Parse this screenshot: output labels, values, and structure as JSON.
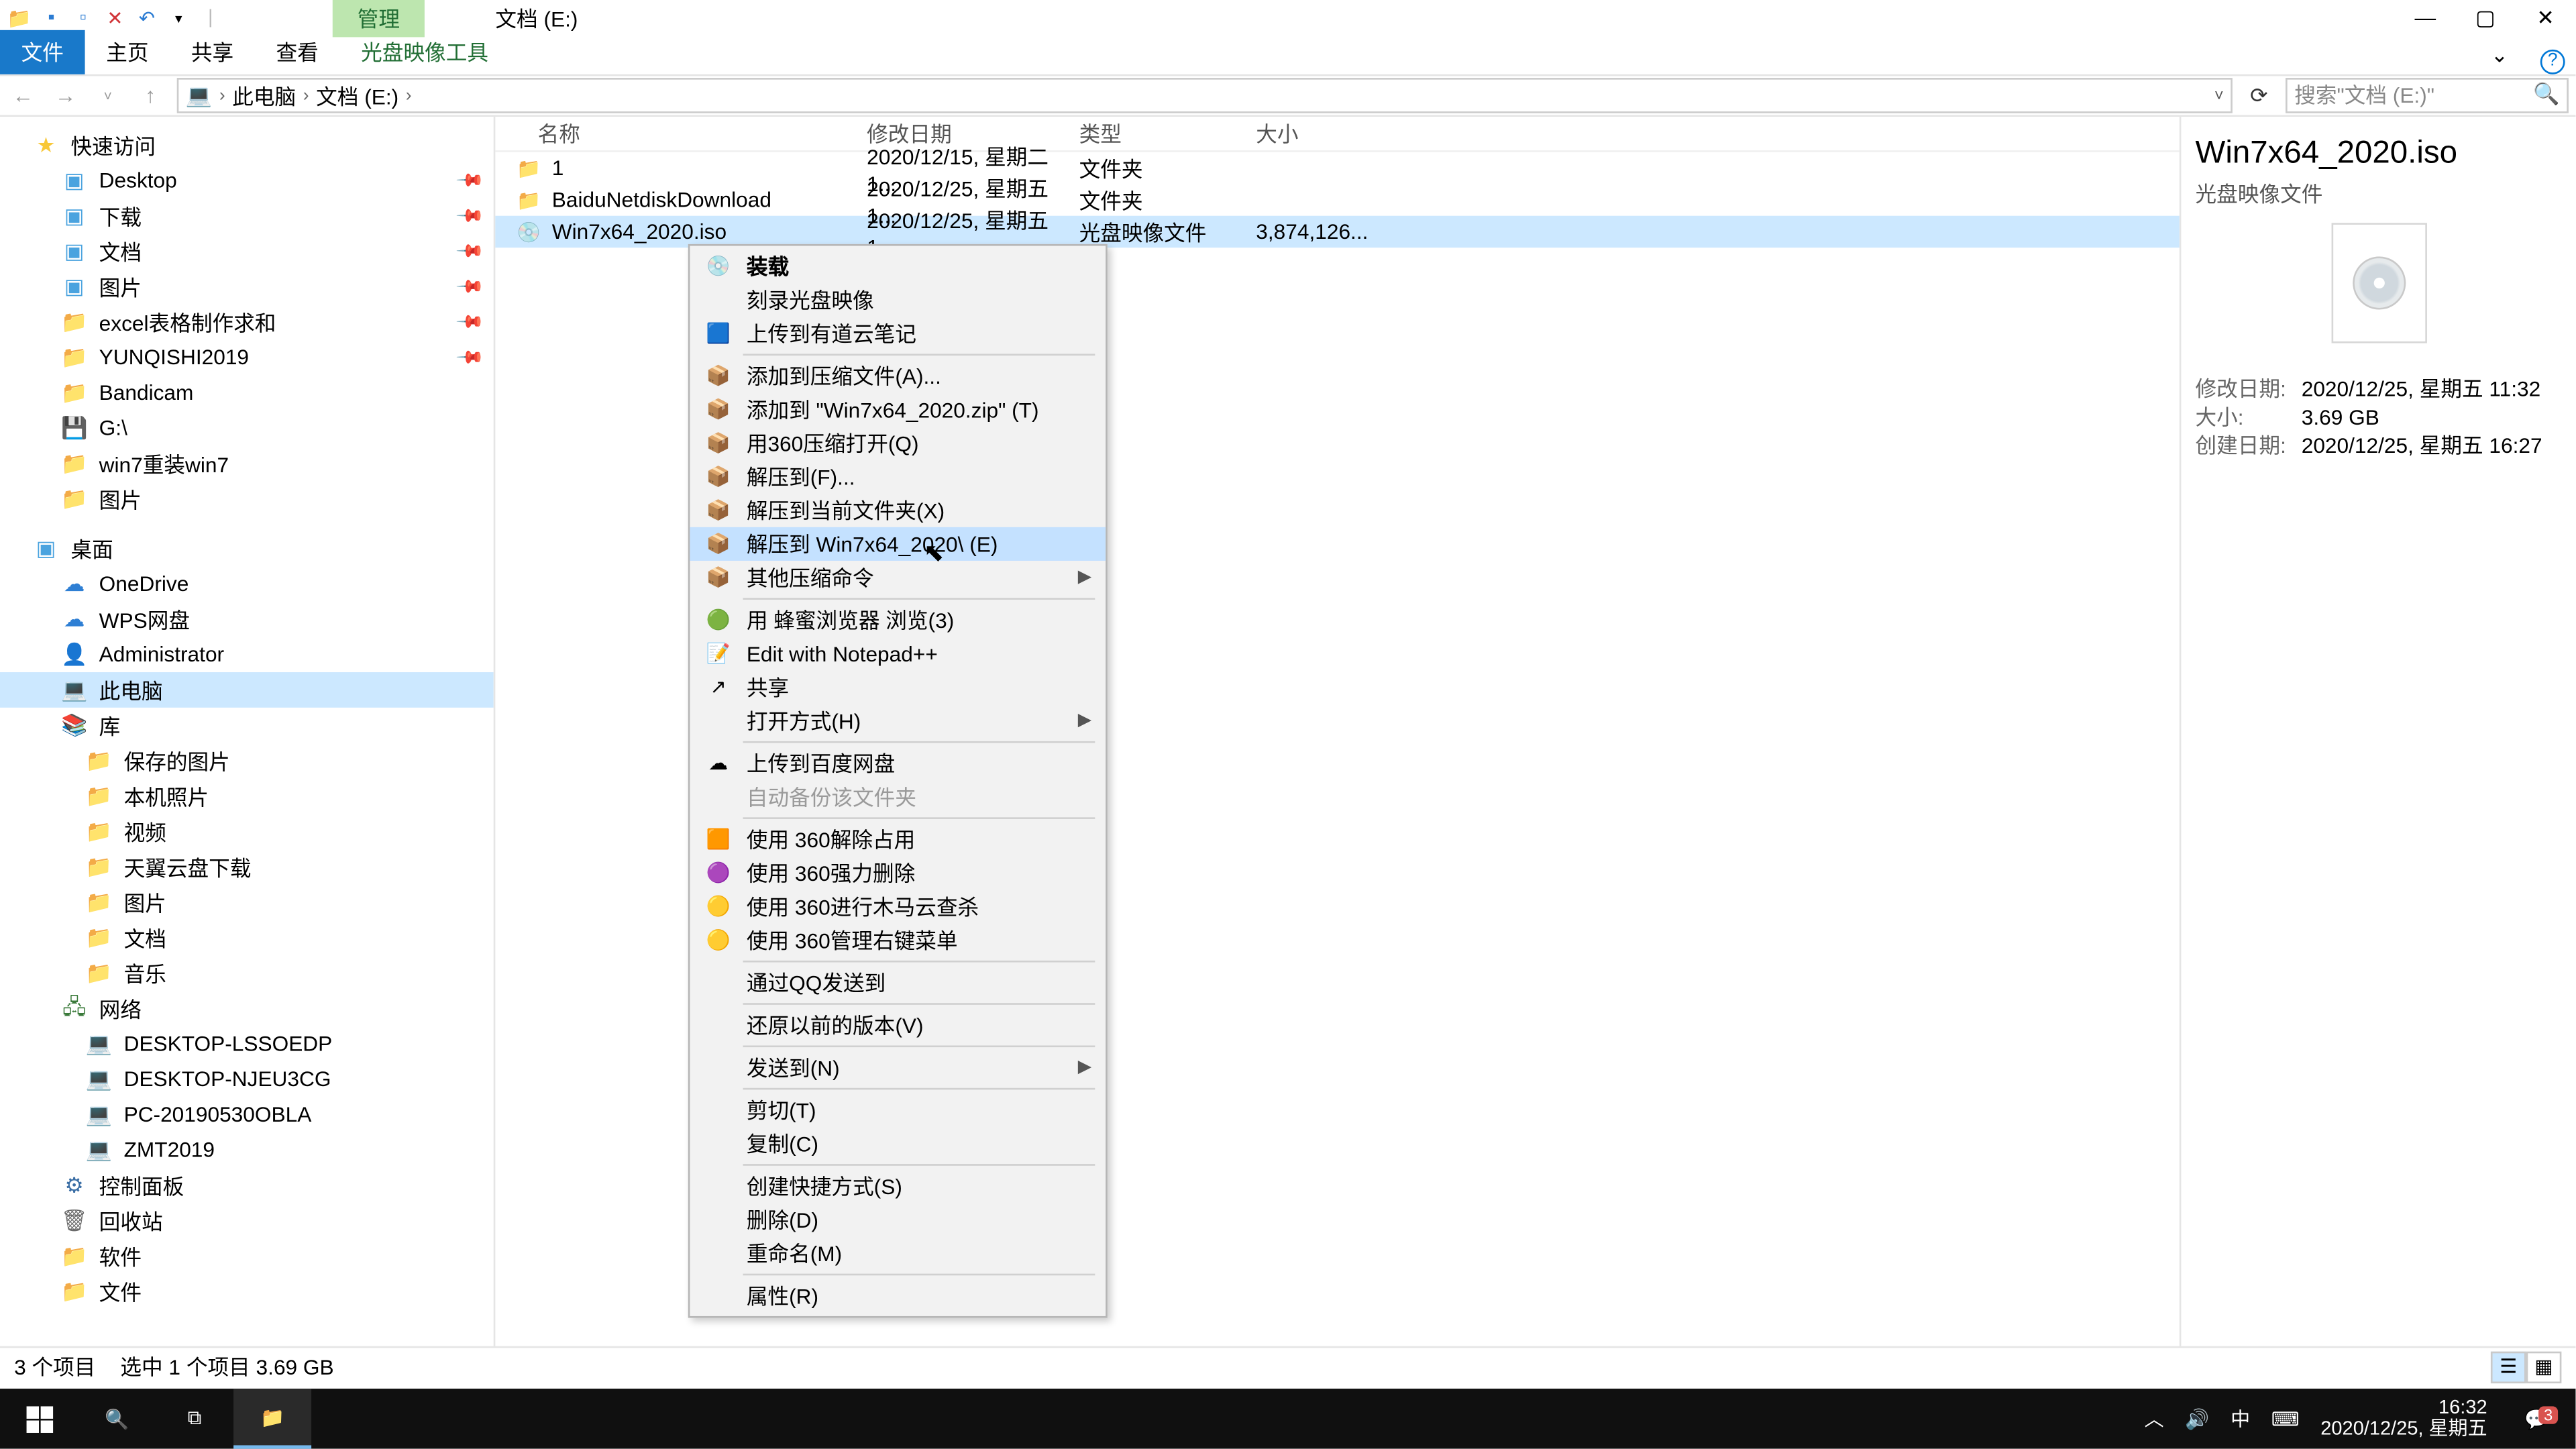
{
  "window": {
    "title": "文档 (E:)",
    "context_tab": "管理"
  },
  "ribbon": {
    "file": "文件",
    "tabs": [
      "主页",
      "共享",
      "查看"
    ],
    "context": "光盘映像工具"
  },
  "address": {
    "crumbs": [
      "此电脑",
      "文档 (E:)"
    ],
    "search_placeholder": "搜索\"文档 (E:)\"",
    "refresh_label": "刷新",
    "history_label": "历史"
  },
  "nav": {
    "quick": {
      "label": "快速访问",
      "items": [
        {
          "label": "Desktop",
          "icon": "blue",
          "pinned": true
        },
        {
          "label": "下载",
          "icon": "blue",
          "pinned": true
        },
        {
          "label": "文档",
          "icon": "blue",
          "pinned": true
        },
        {
          "label": "图片",
          "icon": "blue",
          "pinned": true
        },
        {
          "label": "excel表格制作求和",
          "icon": "folder",
          "pinned": true
        },
        {
          "label": "YUNQISHI2019",
          "icon": "folder",
          "pinned": true
        },
        {
          "label": "Bandicam",
          "icon": "folder"
        },
        {
          "label": "G:\\",
          "icon": "drive"
        },
        {
          "label": "win7重装win7",
          "icon": "folder"
        },
        {
          "label": "图片",
          "icon": "folder"
        }
      ]
    },
    "desktop": {
      "label": "桌面",
      "items": [
        {
          "label": "OneDrive",
          "icon": "cloud"
        },
        {
          "label": "WPS网盘",
          "icon": "cloud"
        },
        {
          "label": "Administrator",
          "icon": "green"
        },
        {
          "label": "此电脑",
          "icon": "pc",
          "selected": true
        },
        {
          "label": "库",
          "icon": "purple"
        }
      ]
    },
    "lib": [
      {
        "label": "保存的图片",
        "icon": "folder"
      },
      {
        "label": "本机照片",
        "icon": "folder"
      },
      {
        "label": "视频",
        "icon": "folder"
      },
      {
        "label": "天翼云盘下载",
        "icon": "folder"
      },
      {
        "label": "图片",
        "icon": "folder"
      },
      {
        "label": "文档",
        "icon": "folder"
      },
      {
        "label": "音乐",
        "icon": "folder"
      }
    ],
    "network": {
      "label": "网络",
      "items": [
        {
          "label": "DESKTOP-LSSOEDP",
          "icon": "pc"
        },
        {
          "label": "DESKTOP-NJEU3CG",
          "icon": "pc"
        },
        {
          "label": "PC-20190530OBLA",
          "icon": "pc"
        },
        {
          "label": "ZMT2019",
          "icon": "pc"
        }
      ]
    },
    "extra": [
      {
        "label": "控制面板",
        "icon": "panel"
      },
      {
        "label": "回收站",
        "icon": "bin"
      },
      {
        "label": "软件",
        "icon": "folder"
      },
      {
        "label": "文件",
        "icon": "folder"
      }
    ]
  },
  "columns": {
    "name": "名称",
    "date": "修改日期",
    "type": "类型",
    "size": "大小"
  },
  "rows": [
    {
      "name": "1",
      "date": "2020/12/15, 星期二 1...",
      "type": "文件夹",
      "size": "",
      "icon": "folder"
    },
    {
      "name": "BaiduNetdiskDownload",
      "date": "2020/12/25, 星期五 1...",
      "type": "文件夹",
      "size": "",
      "icon": "folder"
    },
    {
      "name": "Win7x64_2020.iso",
      "date": "2020/12/25, 星期五 1...",
      "type": "光盘映像文件",
      "size": "3,874,126...",
      "icon": "iso",
      "selected": true
    }
  ],
  "context_menu": {
    "groups": [
      [
        {
          "label": "装载",
          "bold": true,
          "icon": "💿"
        },
        {
          "label": "刻录光盘映像"
        },
        {
          "label": "上传到有道云笔记",
          "icon": "🟦"
        }
      ],
      [
        {
          "label": "添加到压缩文件(A)...",
          "icon": "📦"
        },
        {
          "label": "添加到 \"Win7x64_2020.zip\" (T)",
          "icon": "📦"
        },
        {
          "label": "用360压缩打开(Q)",
          "icon": "📦"
        },
        {
          "label": "解压到(F)...",
          "icon": "📦"
        },
        {
          "label": "解压到当前文件夹(X)",
          "icon": "📦"
        },
        {
          "label": "解压到 Win7x64_2020\\ (E)",
          "icon": "📦",
          "hover": true
        },
        {
          "label": "其他压缩命令",
          "icon": "📦",
          "submenu": true
        }
      ],
      [
        {
          "label": "用 蜂蜜浏览器 浏览(3)",
          "icon": "🟢"
        },
        {
          "label": "Edit with Notepad++",
          "icon": "📝"
        },
        {
          "label": "共享",
          "icon": "↗"
        },
        {
          "label": "打开方式(H)",
          "submenu": true
        }
      ],
      [
        {
          "label": "上传到百度网盘",
          "icon": "☁"
        },
        {
          "label": "自动备份该文件夹",
          "disabled": true
        }
      ],
      [
        {
          "label": "使用 360解除占用",
          "icon": "🟧"
        },
        {
          "label": "使用 360强力删除",
          "icon": "🟣"
        },
        {
          "label": "使用 360进行木马云查杀",
          "icon": "🟡"
        },
        {
          "label": "使用 360管理右键菜单",
          "icon": "🟡"
        }
      ],
      [
        {
          "label": "通过QQ发送到"
        }
      ],
      [
        {
          "label": "还原以前的版本(V)"
        }
      ],
      [
        {
          "label": "发送到(N)",
          "submenu": true
        }
      ],
      [
        {
          "label": "剪切(T)"
        },
        {
          "label": "复制(C)"
        }
      ],
      [
        {
          "label": "创建快捷方式(S)"
        },
        {
          "label": "删除(D)"
        },
        {
          "label": "重命名(M)"
        }
      ],
      [
        {
          "label": "属性(R)"
        }
      ]
    ]
  },
  "details": {
    "title": "Win7x64_2020.iso",
    "subtitle": "光盘映像文件",
    "props": [
      {
        "k": "修改日期:",
        "v": "2020/12/25, 星期五 11:32"
      },
      {
        "k": "大小:",
        "v": "3.69 GB"
      },
      {
        "k": "创建日期:",
        "v": "2020/12/25, 星期五 16:27"
      }
    ]
  },
  "status": {
    "count": "3 个项目",
    "selection": "选中 1 个项目  3.69 GB"
  },
  "taskbar": {
    "time": "16:32",
    "date": "2020/12/25, 星期五",
    "ime": "中",
    "tray_up": "︿",
    "notif_count": "3"
  }
}
